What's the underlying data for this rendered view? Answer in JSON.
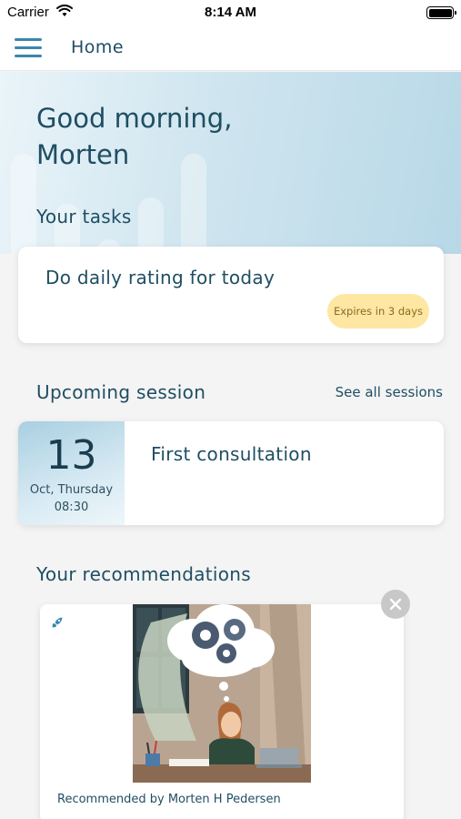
{
  "status_bar": {
    "carrier": "Carrier",
    "time": "8:14 AM"
  },
  "nav": {
    "title": "Home",
    "menu_icon": "hamburger-menu-icon"
  },
  "greeting": {
    "line1": "Good morning,",
    "line2": "Morten"
  },
  "tasks": {
    "section_title": "Your tasks",
    "items": [
      {
        "title": "Do daily rating for today",
        "badge": "Expires in 3 days"
      }
    ]
  },
  "session": {
    "section_title": "Upcoming session",
    "see_all_label": "See all sessions",
    "day": "13",
    "month_weekday": "Oct, Thursday",
    "time": "08:30",
    "title": "First consultation"
  },
  "recommendations": {
    "section_title": "Your recommendations",
    "recommended_by": "Recommended by Morten H Pedersen",
    "type_icon": "rocket-icon",
    "close_icon": "close-icon"
  },
  "colors": {
    "primary_text": "#1f4e63",
    "accent_blue": "#3a86ad",
    "badge_bg": "#fde7a2",
    "badge_text": "#8a6b1f"
  }
}
